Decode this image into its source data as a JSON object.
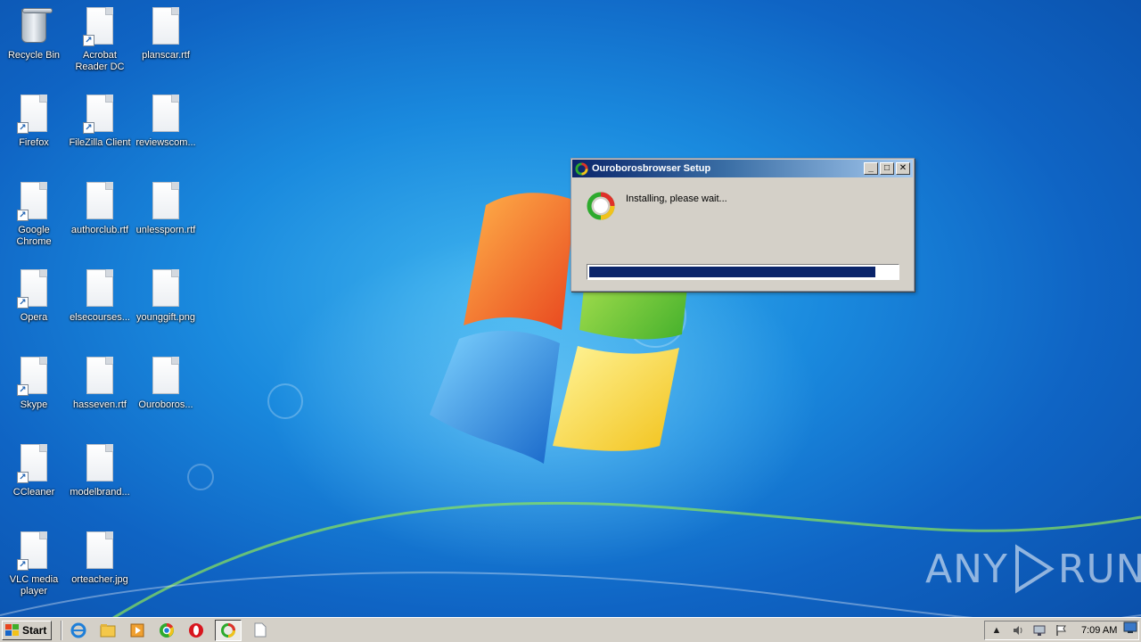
{
  "desktop": {
    "icons": [
      {
        "label": "Recycle Bin",
        "type": "bin"
      },
      {
        "label": "Acrobat Reader DC",
        "type": "shortcut"
      },
      {
        "label": "planscar.rtf",
        "type": "file"
      },
      {
        "label": "Firefox",
        "type": "shortcut"
      },
      {
        "label": "FileZilla Client",
        "type": "shortcut"
      },
      {
        "label": "reviewscom...",
        "type": "file"
      },
      {
        "label": "Google Chrome",
        "type": "shortcut"
      },
      {
        "label": "authorclub.rtf",
        "type": "file"
      },
      {
        "label": "unlessporn.rtf",
        "type": "file"
      },
      {
        "label": "Opera",
        "type": "shortcut"
      },
      {
        "label": "elsecourses...",
        "type": "file"
      },
      {
        "label": "younggift.png",
        "type": "file"
      },
      {
        "label": "Skype",
        "type": "shortcut"
      },
      {
        "label": "hasseven.rtf",
        "type": "file"
      },
      {
        "label": "Ouroboros...",
        "type": "file"
      },
      {
        "label": "CCleaner",
        "type": "shortcut"
      },
      {
        "label": "modelbrand...",
        "type": "file"
      },
      {
        "label": "VLC media player",
        "type": "shortcut"
      },
      {
        "label": "orteacher.jpg",
        "type": "file"
      }
    ]
  },
  "dialog": {
    "title": "Ouroborosbrowser Setup",
    "status": "Installing, please wait...",
    "progress_fraction": 0.93,
    "minimize_label": "_",
    "maximize_label": "□",
    "close_label": "✕",
    "icon": "ouroboros-icon"
  },
  "taskbar": {
    "start_label": "Start",
    "clock": "7:09 AM",
    "items": [
      "ie-icon",
      "explorer-icon",
      "media-player-icon",
      "chrome-icon",
      "opera-icon",
      "ouroboros-setup-icon",
      "document-icon"
    ],
    "tray": [
      "chevron-up-icon",
      "speaker-icon",
      "network-icon",
      "flag-icon"
    ]
  },
  "watermark": {
    "text_left": "ANY",
    "text_right": "RUN"
  },
  "colors": {
    "titlebar_start": "#0a246a",
    "progress_fill": "#0a246a",
    "dialog_face": "#d4d0c8"
  }
}
